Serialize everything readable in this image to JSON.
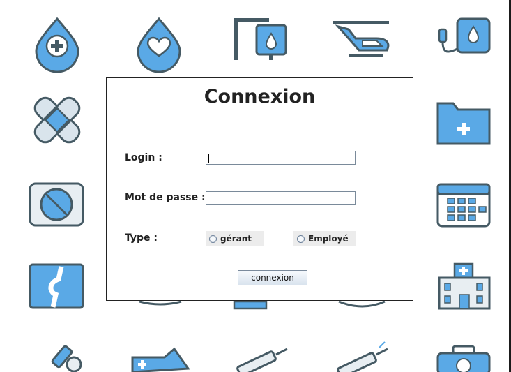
{
  "dialog": {
    "title": "Connexion",
    "login_label": "Login :",
    "login_value": "",
    "password_label": "Mot de passe :",
    "password_value": "",
    "type_label": "Type :",
    "type_options": [
      "gérant",
      "Employé"
    ],
    "submit_label": "connexion"
  },
  "colors": {
    "icon_blue": "#5aa9e6",
    "icon_outline": "#455a64",
    "background": "#ffffff"
  },
  "background_icons": [
    "blood-drop-plus-icon",
    "heart-drop-icon",
    "iv-drip-icon",
    "helicopter-icon",
    "blood-bag-icon",
    "bandage-icon",
    "medical-folder-icon",
    "pill-icon",
    "calendar-icon",
    "knee-xray-icon",
    "hospital-icon",
    "microscope-icon",
    "ambulance-icon",
    "syringe-icon",
    "syringe-icon",
    "first-aid-kit-icon"
  ]
}
